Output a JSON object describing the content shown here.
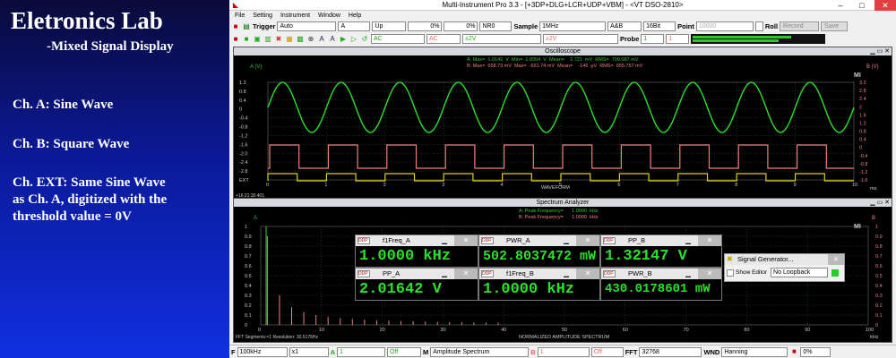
{
  "slide": {
    "title": "Eletronics Lab",
    "subtitle": "-Mixed Signal Display",
    "lines": [
      "Ch. A: Sine Wave",
      "Ch. B: Square Wave",
      "Ch. EXT: Same Sine Wave",
      "as Ch. A, digitized with the",
      "threshold value = 0V"
    ]
  },
  "app": {
    "title": "Multi-Instrument Pro 3.3   -  [+3DP+DLG+LCR+UDP+VBM]   -  <VT DSO-2810>",
    "menu": [
      "File",
      "Setting",
      "Instrument",
      "Window",
      "Help"
    ]
  },
  "toolbar1": {
    "trigger": "Trigger",
    "mode": "Auto",
    "source": "A",
    "edge": "Up",
    "level1": "0%",
    "level2": "0%",
    "nr": "NR0",
    "sample_label": "Sample",
    "sample_rate": "1MHz",
    "channels": "A&B",
    "bits": "16Bit",
    "point_label": "Point",
    "points": "10000",
    "roll": "Roll",
    "record": "Record",
    "save": "Save"
  },
  "toolbar2": {
    "coupling_a": "AC",
    "coupling_b": "AC",
    "range_a": "±2V",
    "range_b": "±2V",
    "probe_label": "Probe",
    "probe_a": "1",
    "probe_b": "1"
  },
  "oscilloscope": {
    "title": "Oscilloscope",
    "stats_a": "A: Max=  1.0142  V  Min= -1.0054  V  Mean=    2.721  mV  RMS=  709.087 mV",
    "stats_b": "B: Max=  658.73 mV  Max=  -661.74 mV  Mean=    -146  µV  RMS=  655.757 mV",
    "left_unit": "A (V)",
    "right_unit": "B (V)",
    "left_ticks": [
      "1.2",
      "0.8",
      "0.4",
      "0",
      "-0.4",
      "-0.8",
      "-1.2",
      "-1.6",
      "-2.0",
      "-2.4",
      "-2.8",
      "EXT"
    ],
    "right_ticks": [
      "3.2",
      "2.8",
      "2.4",
      "2",
      "1.6",
      "1.2",
      "0.8",
      "0.4",
      "0",
      "-0.4",
      "-0.8",
      "-1.2",
      "-1.6"
    ],
    "x_ticks": [
      "0",
      "1",
      "2",
      "3",
      "4",
      "5",
      "6",
      "7",
      "8",
      "9",
      "10"
    ],
    "x_unit": "ms",
    "xlabel": "WAVEFORM",
    "timestamp": "+16:21:30.401",
    "badge": "MI"
  },
  "spectrum": {
    "title": "Spectrum Analyzer",
    "peak_a": "A: Peak Frequency=      1.0000  kHz",
    "peak_b": "B: Peak Frequency=      1.0000  kHz",
    "left_unit": "A",
    "right_unit": "B",
    "left_ticks": [
      "1",
      "0.9",
      "0.8",
      "0.7",
      "0.6",
      "0.5",
      "0.4",
      "0.3",
      "0.2",
      "0.1",
      "0"
    ],
    "right_ticks": [
      "1",
      "0.9",
      "0.8",
      "0.7",
      "0.6",
      "0.5",
      "0.4",
      "0.3",
      "0.2",
      "0.1",
      "0"
    ],
    "x_ticks": [
      "0",
      "10",
      "20",
      "30",
      "40",
      "50",
      "60",
      "70",
      "80",
      "90",
      "100"
    ],
    "x_unit": "kHz",
    "xlabel": "NORMALIZED AMPLITUDE SPECTRUM",
    "footer_left": "FFT  Segments:<1      Resolution: 30.5176Hz",
    "badge": "MI"
  },
  "meters": [
    {
      "title": "f1Freq_A",
      "value": "1.0000 kHz"
    },
    {
      "title": "PWR_A",
      "value": "502.8037472 mW"
    },
    {
      "title": "PP_B",
      "value": "1.32147 V"
    },
    {
      "title": "PP_A",
      "value": "2.01642 V"
    },
    {
      "title": "f1Freq_B",
      "value": "1.0000 kHz"
    },
    {
      "title": "PWR_B",
      "value": "430.0178601 mW"
    }
  ],
  "siggen": {
    "title": "Signal Generator...",
    "show_editor": "Show Editor",
    "loop": "No Loopback"
  },
  "statusbar": {
    "f_label": "F",
    "f_value": "100kHz",
    "mult": "x1",
    "a_label": "A",
    "a_value": "1",
    "a_off": "Off",
    "m_label": "M",
    "mode": "Amplitude Spectrum",
    "b_label": "B",
    "b_value": "1",
    "b_off": "Off",
    "fft_label": "FFT",
    "fft_size": "32768",
    "wnd_label": "WND",
    "window": "Hanning",
    "pct": "0%"
  },
  "colors": {
    "channel_a": "#2ee02e",
    "channel_b": "#f08080",
    "ext": "#e0d020",
    "grid": "#2a6a2a"
  },
  "chart_data": [
    {
      "type": "line",
      "title": "Oscilloscope",
      "xlabel": "WAVEFORM",
      "x_unit": "ms",
      "xlim": [
        0,
        10
      ],
      "series": [
        {
          "name": "A",
          "kind": "sine",
          "amplitude": 1.0142,
          "offset": 0,
          "frequency_khz": 1.0
        },
        {
          "name": "B",
          "kind": "square",
          "high": 0.65873,
          "low": -0.66174,
          "frequency_khz": 1.0
        },
        {
          "name": "EXT",
          "kind": "digital",
          "threshold": 0,
          "frequency_khz": 1.0
        }
      ]
    },
    {
      "type": "bar",
      "title": "Spectrum Analyzer",
      "xlabel": "NORMALIZED AMPLITUDE SPECTRUM",
      "x_unit": "kHz",
      "xlim": [
        0,
        100
      ],
      "ylim": [
        0,
        1
      ],
      "series": [
        {
          "name": "A",
          "x": [
            1
          ],
          "values": [
            1.0
          ]
        },
        {
          "name": "B",
          "x": [
            1,
            3,
            5,
            7,
            9,
            11,
            13,
            15,
            17,
            19,
            21,
            23,
            25,
            27,
            29,
            31,
            33,
            35,
            37,
            39
          ],
          "values": [
            0.9,
            0.3,
            0.18,
            0.13,
            0.1,
            0.082,
            0.069,
            0.06,
            0.053,
            0.047,
            0.043,
            0.039,
            0.036,
            0.033,
            0.031,
            0.029,
            0.027,
            0.026,
            0.024,
            0.023
          ]
        }
      ]
    }
  ]
}
